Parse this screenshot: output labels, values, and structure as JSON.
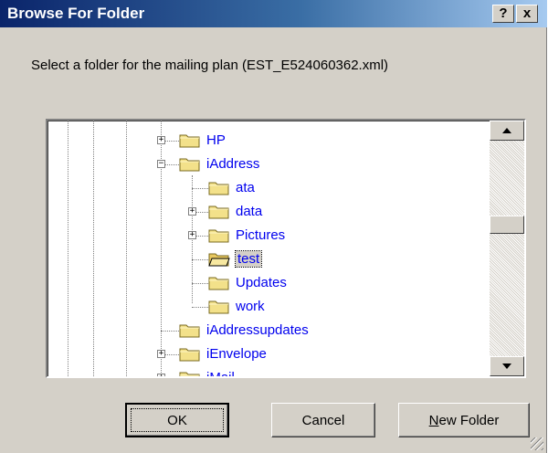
{
  "window": {
    "title": "Browse For Folder",
    "help_label": "?",
    "close_label": "x"
  },
  "prompt": "Select a folder for the mailing plan (EST_E524060362.xml)",
  "tree": {
    "items": [
      {
        "label": "HP",
        "expander": "+",
        "selected": false
      },
      {
        "label": "iAddress",
        "expander": "−",
        "selected": false
      },
      {
        "label": "ata",
        "expander": "",
        "selected": false
      },
      {
        "label": "data",
        "expander": "+",
        "selected": false
      },
      {
        "label": "Pictures",
        "expander": "+",
        "selected": false
      },
      {
        "label": "test",
        "expander": "",
        "selected": true
      },
      {
        "label": "Updates",
        "expander": "",
        "selected": false
      },
      {
        "label": "work",
        "expander": "",
        "selected": false
      },
      {
        "label": "iAddressupdates",
        "expander": "",
        "selected": false
      },
      {
        "label": "iEnvelope",
        "expander": "+",
        "selected": false
      },
      {
        "label": "iMail",
        "expander": "+",
        "selected": false
      }
    ]
  },
  "buttons": {
    "ok": "OK",
    "cancel": "Cancel",
    "new_folder": "New Folder",
    "new_folder_mnemonic": "N",
    "new_folder_rest": "ew Folder"
  },
  "colors": {
    "title_start": "#0a246a",
    "title_end": "#a6caf0",
    "face": "#d4d0c8",
    "link": "#0000ee"
  }
}
